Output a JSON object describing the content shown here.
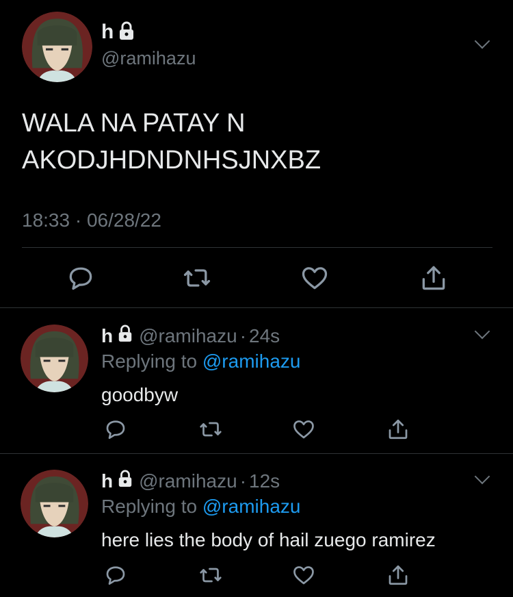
{
  "main_tweet": {
    "display_name": "h",
    "handle": "@ramihazu",
    "text_line1": "WALA NA PATAY N",
    "text_line2": "AKODJHDNDNHSJNXBZ",
    "timestamp": "18:33 · 06/28/22",
    "icons": [
      "reply-icon",
      "retweet-icon",
      "like-icon",
      "share-icon",
      "lock-icon",
      "chevron-down-icon"
    ]
  },
  "replies": [
    {
      "display_name": "h",
      "handle": "@ramihazu",
      "separator": "·",
      "age": "24s",
      "replying_prefix": "Replying to",
      "replying_handle": "@ramihazu",
      "text": "goodbyw"
    },
    {
      "display_name": "h",
      "handle": "@ramihazu",
      "separator": "·",
      "age": "12s",
      "replying_prefix": "Replying to",
      "replying_handle": "@ramihazu",
      "text": "here lies the body of hail zuego ramirez"
    }
  ],
  "colors": {
    "background": "#000000",
    "text": "#d9d9d9",
    "secondary": "#6e767d",
    "link": "#1d9bf0",
    "divider": "#2f3336"
  }
}
